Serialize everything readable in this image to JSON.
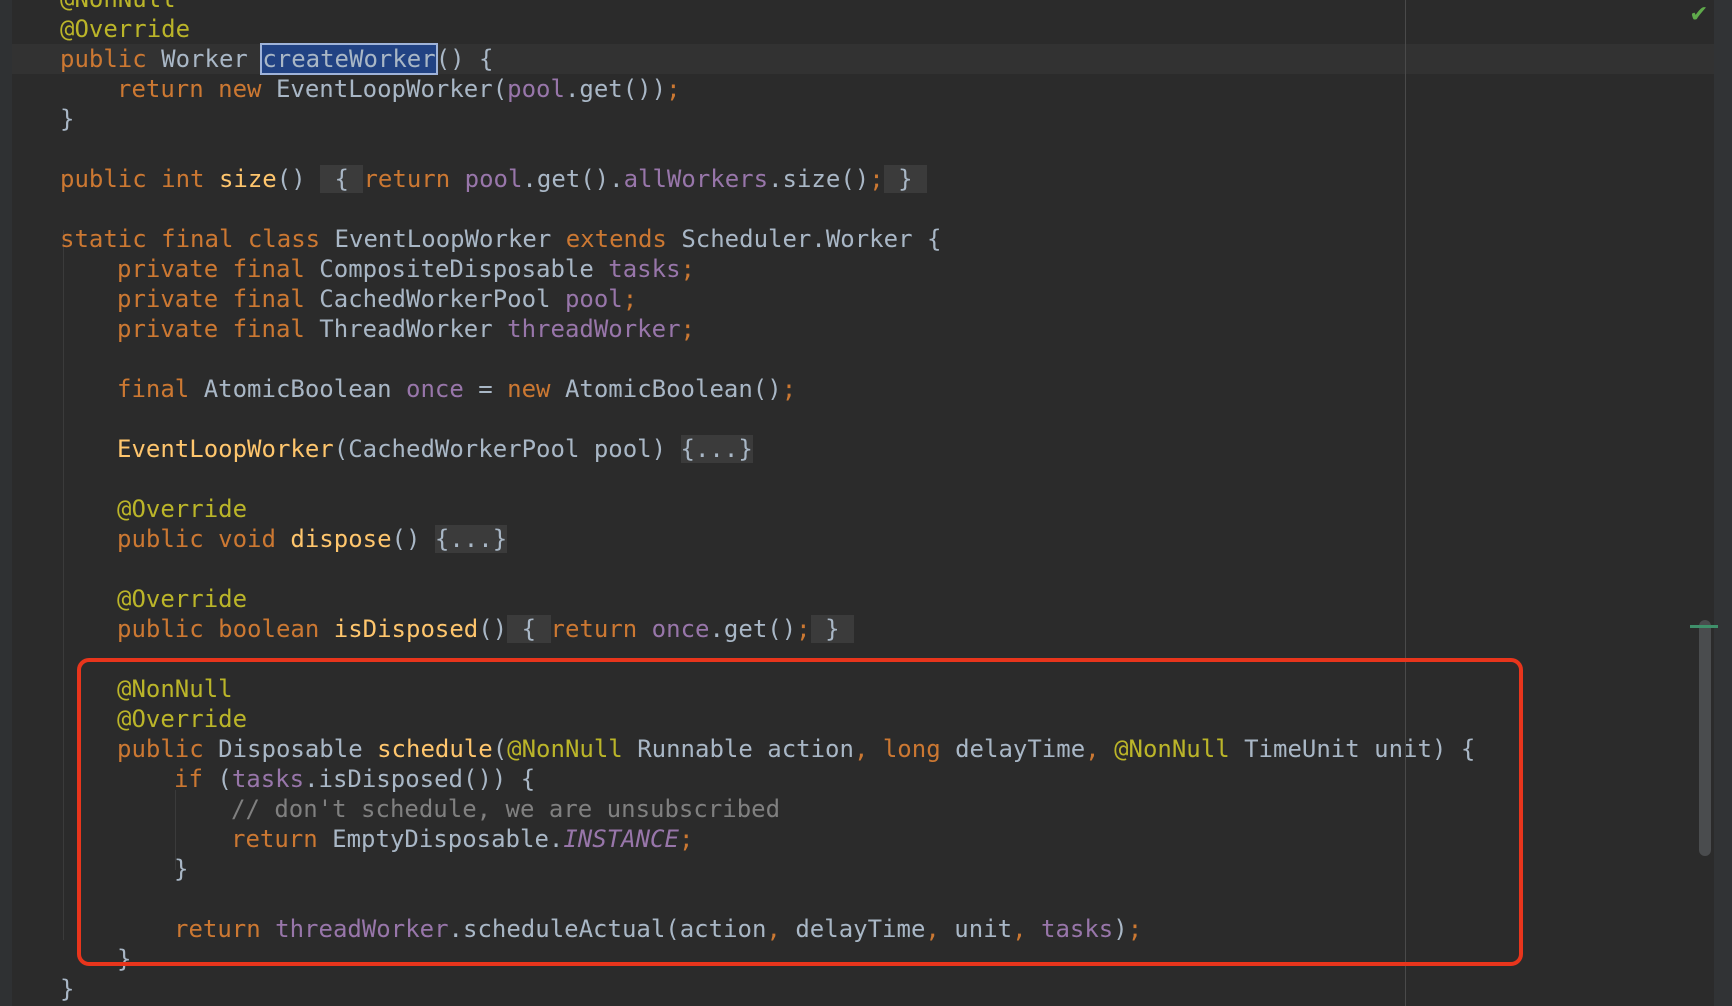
{
  "editor": {
    "lines": [
      {
        "row": 1,
        "indent": 0,
        "tokens": [
          {
            "text": "@NonNull",
            "type": "anno"
          }
        ]
      },
      {
        "row": 2,
        "indent": 0,
        "tokens": [
          {
            "text": "@Override",
            "type": "anno"
          }
        ]
      },
      {
        "row": 3,
        "indent": 0,
        "current": true,
        "tokens": [
          {
            "text": "public ",
            "type": "kw"
          },
          {
            "text": "Worker ",
            "type": "plain"
          },
          {
            "text": "createWorker",
            "type": "sel"
          },
          {
            "text": "() {",
            "type": "plain"
          }
        ]
      },
      {
        "row": 4,
        "indent": 1,
        "tokens": [
          {
            "text": "return new ",
            "type": "kw"
          },
          {
            "text": "EventLoopWorker(",
            "type": "plain"
          },
          {
            "text": "pool",
            "type": "field"
          },
          {
            "text": ".get())",
            "type": "plain"
          },
          {
            "text": ";",
            "type": "kw"
          }
        ]
      },
      {
        "row": 5,
        "indent": 0,
        "tokens": [
          {
            "text": "}",
            "type": "plain"
          }
        ]
      },
      {
        "row": 7,
        "indent": 0,
        "tokens": [
          {
            "text": "public int ",
            "type": "kw"
          },
          {
            "text": "size",
            "type": "method"
          },
          {
            "text": "() ",
            "type": "plain"
          },
          {
            "text": " { ",
            "type": "fold"
          },
          {
            "text": "return ",
            "type": "kw"
          },
          {
            "text": "pool",
            "type": "field"
          },
          {
            "text": ".get().",
            "type": "plain"
          },
          {
            "text": "allWorkers",
            "type": "field"
          },
          {
            "text": ".size()",
            "type": "plain"
          },
          {
            "text": ";",
            "type": "kw"
          },
          {
            "text": " } ",
            "type": "fold"
          }
        ]
      },
      {
        "row": 9,
        "indent": 0,
        "tokens": [
          {
            "text": "static final class ",
            "type": "kw"
          },
          {
            "text": "EventLoopWorker ",
            "type": "plain"
          },
          {
            "text": "extends ",
            "type": "kw"
          },
          {
            "text": "Scheduler.Worker {",
            "type": "plain"
          }
        ]
      },
      {
        "row": 10,
        "indent": 1,
        "tokens": [
          {
            "text": "private final ",
            "type": "kw"
          },
          {
            "text": "CompositeDisposable ",
            "type": "plain"
          },
          {
            "text": "tasks",
            "type": "field"
          },
          {
            "text": ";",
            "type": "kw"
          }
        ]
      },
      {
        "row": 11,
        "indent": 1,
        "tokens": [
          {
            "text": "private final ",
            "type": "kw"
          },
          {
            "text": "CachedWorkerPool ",
            "type": "plain"
          },
          {
            "text": "pool",
            "type": "field"
          },
          {
            "text": ";",
            "type": "kw"
          }
        ]
      },
      {
        "row": 12,
        "indent": 1,
        "tokens": [
          {
            "text": "private final ",
            "type": "kw"
          },
          {
            "text": "ThreadWorker ",
            "type": "plain"
          },
          {
            "text": "threadWorker",
            "type": "field"
          },
          {
            "text": ";",
            "type": "kw"
          }
        ]
      },
      {
        "row": 14,
        "indent": 1,
        "tokens": [
          {
            "text": "final ",
            "type": "kw"
          },
          {
            "text": "AtomicBoolean ",
            "type": "plain"
          },
          {
            "text": "once ",
            "type": "field"
          },
          {
            "text": "= ",
            "type": "plain"
          },
          {
            "text": "new ",
            "type": "kw"
          },
          {
            "text": "AtomicBoolean()",
            "type": "plain"
          },
          {
            "text": ";",
            "type": "kw"
          }
        ]
      },
      {
        "row": 16,
        "indent": 1,
        "tokens": [
          {
            "text": "EventLoopWorker",
            "type": "method"
          },
          {
            "text": "(CachedWorkerPool pool) ",
            "type": "plain"
          },
          {
            "text": "{...}",
            "type": "fold"
          }
        ]
      },
      {
        "row": 18,
        "indent": 1,
        "tokens": [
          {
            "text": "@Override",
            "type": "anno"
          }
        ]
      },
      {
        "row": 19,
        "indent": 1,
        "tokens": [
          {
            "text": "public void ",
            "type": "kw"
          },
          {
            "text": "dispose",
            "type": "method"
          },
          {
            "text": "() ",
            "type": "plain"
          },
          {
            "text": "{...}",
            "type": "fold"
          }
        ]
      },
      {
        "row": 21,
        "indent": 1,
        "tokens": [
          {
            "text": "@Override",
            "type": "anno"
          }
        ]
      },
      {
        "row": 22,
        "indent": 1,
        "tokens": [
          {
            "text": "public boolean ",
            "type": "kw"
          },
          {
            "text": "isDisposed",
            "type": "method"
          },
          {
            "text": "()",
            "type": "plain"
          },
          {
            "text": " { ",
            "type": "fold"
          },
          {
            "text": "return ",
            "type": "kw"
          },
          {
            "text": "once",
            "type": "field"
          },
          {
            "text": ".get()",
            "type": "plain"
          },
          {
            "text": ";",
            "type": "kw"
          },
          {
            "text": " } ",
            "type": "fold"
          }
        ]
      },
      {
        "row": 24,
        "indent": 1,
        "tokens": [
          {
            "text": "@NonNull",
            "type": "anno"
          }
        ]
      },
      {
        "row": 25,
        "indent": 1,
        "tokens": [
          {
            "text": "@Override",
            "type": "anno"
          }
        ]
      },
      {
        "row": 26,
        "indent": 1,
        "tokens": [
          {
            "text": "public ",
            "type": "kw"
          },
          {
            "text": "Disposable ",
            "type": "plain"
          },
          {
            "text": "schedule",
            "type": "method"
          },
          {
            "text": "(",
            "type": "plain"
          },
          {
            "text": "@NonNull ",
            "type": "anno"
          },
          {
            "text": "Runnable action",
            "type": "plain"
          },
          {
            "text": ", ",
            "type": "kw"
          },
          {
            "text": "long ",
            "type": "kw"
          },
          {
            "text": "delayTime",
            "type": "plain"
          },
          {
            "text": ", ",
            "type": "kw"
          },
          {
            "text": "@NonNull ",
            "type": "anno"
          },
          {
            "text": "TimeUnit unit) {",
            "type": "plain"
          }
        ]
      },
      {
        "row": 27,
        "indent": 2,
        "tokens": [
          {
            "text": "if ",
            "type": "kw"
          },
          {
            "text": "(",
            "type": "plain"
          },
          {
            "text": "tasks",
            "type": "field"
          },
          {
            "text": ".isDisposed()) {",
            "type": "plain"
          }
        ]
      },
      {
        "row": 28,
        "indent": 3,
        "tokens": [
          {
            "text": "// don't schedule, we are unsubscribed",
            "type": "comment"
          }
        ]
      },
      {
        "row": 29,
        "indent": 3,
        "tokens": [
          {
            "text": "return ",
            "type": "kw"
          },
          {
            "text": "EmptyDisposable.",
            "type": "plain"
          },
          {
            "text": "INSTANCE",
            "type": "static"
          },
          {
            "text": ";",
            "type": "kw"
          }
        ]
      },
      {
        "row": 30,
        "indent": 2,
        "tokens": [
          {
            "text": "}",
            "type": "plain"
          }
        ]
      },
      {
        "row": 32,
        "indent": 2,
        "tokens": [
          {
            "text": "return ",
            "type": "kw"
          },
          {
            "text": "threadWorker",
            "type": "field"
          },
          {
            "text": ".scheduleActual(action",
            "type": "plain"
          },
          {
            "text": ", ",
            "type": "kw"
          },
          {
            "text": "delayTime",
            "type": "plain"
          },
          {
            "text": ", ",
            "type": "kw"
          },
          {
            "text": "unit",
            "type": "plain"
          },
          {
            "text": ", ",
            "type": "kw"
          },
          {
            "text": "tasks",
            "type": "field"
          },
          {
            "text": ")",
            "type": "plain"
          },
          {
            "text": ";",
            "type": "kw"
          }
        ]
      },
      {
        "row": 33,
        "indent": 1,
        "tokens": [
          {
            "text": "}",
            "type": "plain"
          }
        ]
      },
      {
        "row": 34,
        "indent": 0,
        "tokens": [
          {
            "text": "}",
            "type": "plain"
          }
        ]
      }
    ]
  },
  "colors": {
    "background": "#2b2b2b",
    "keyword": "#cc7832",
    "field": "#9876aa",
    "method": "#ffc66d",
    "annotation": "#bbb529",
    "comment": "#808080",
    "highlight_box": "#e8351c"
  },
  "icons": {
    "inspection_status": "checkmark-icon"
  },
  "status": {
    "inspection_glyph": "✔"
  }
}
